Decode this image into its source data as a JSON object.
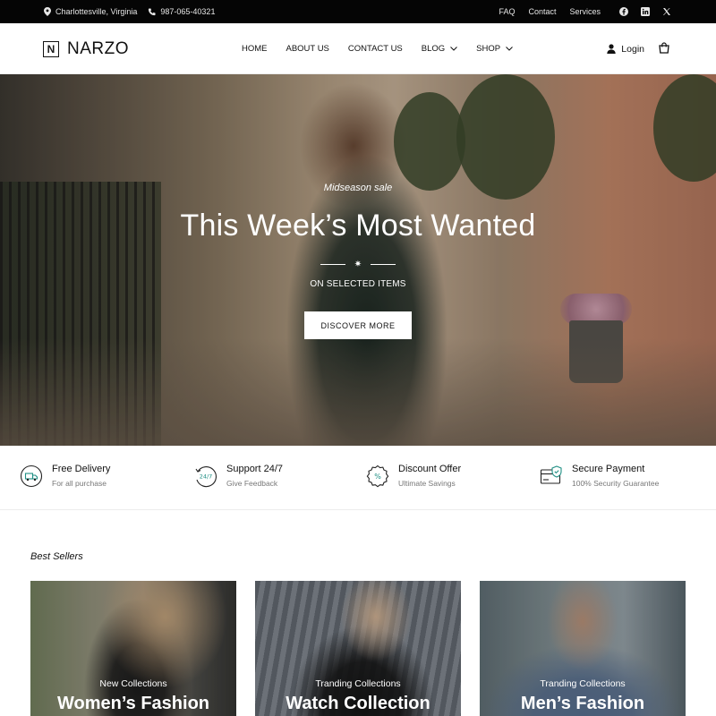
{
  "topbar": {
    "location": "Charlottesville, Virginia",
    "phone": "987-065-40321",
    "links": [
      "FAQ",
      "Contact",
      "Services"
    ],
    "social": [
      "facebook-icon",
      "linkedin-icon",
      "x-icon"
    ]
  },
  "header": {
    "logo_mark": "N",
    "logo_text": "NARZO",
    "nav": [
      {
        "label": "HOME"
      },
      {
        "label": "ABOUT US"
      },
      {
        "label": "CONTACT US"
      },
      {
        "label": "BLOG"
      },
      {
        "label": "SHOP"
      }
    ],
    "login_label": "Login"
  },
  "hero": {
    "pretitle": "Midseason sale",
    "title": "This Week’s Most Wanted",
    "subtitle": "ON SELECTED ITEMS",
    "cta_label": "DISCOVER MORE"
  },
  "features": [
    {
      "title": "Free Delivery",
      "subtitle": "For all purchase",
      "icon": "delivery-truck-icon"
    },
    {
      "title": "Support 24/7",
      "subtitle": "Give Feedback",
      "icon": "support-24-7-icon"
    },
    {
      "title": "Discount Offer",
      "subtitle": "Ultimate Savings",
      "icon": "discount-badge-icon"
    },
    {
      "title": "Secure Payment",
      "subtitle": "100% Security Guarantee",
      "icon": "secure-card-icon"
    }
  ],
  "best_sellers": {
    "title": "Best Sellers",
    "cards": [
      {
        "kicker": "New Collections",
        "title": "Women’s Fashion"
      },
      {
        "kicker": "Tranding Collections",
        "title": "Watch Collection"
      },
      {
        "kicker": "Tranding Collections",
        "title": "Men’s Fashion"
      }
    ]
  },
  "colors": {
    "topbar_bg": "#050505",
    "teal_accent": "#1f8f84"
  }
}
